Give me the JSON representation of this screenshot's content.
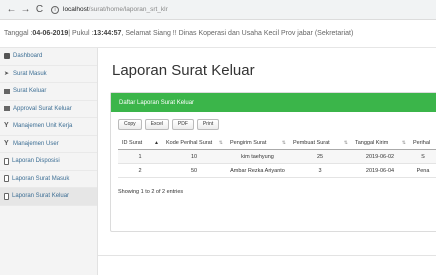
{
  "browser": {
    "back": "←",
    "forward": "→",
    "reload": "C",
    "info": "i",
    "url_host": "localhost",
    "url_path": "/surat/home/laporan_srt_klr"
  },
  "topbar": {
    "prefix": "Tanggal : ",
    "date": "04-06-2019",
    "mid": " | Pukul : ",
    "time": "13:44:57",
    "greeting": " , Selamat Siang !! Dinas Koperasi dan Usaha Kecil Prov jabar (Sekretariat)"
  },
  "sidebar": {
    "items": [
      {
        "label": "Dashboard"
      },
      {
        "label": "Surat Masuk"
      },
      {
        "label": "Surat Keluar"
      },
      {
        "label": "Approval Surat Keluar"
      },
      {
        "label": "Manajemen Unit Kerja"
      },
      {
        "label": "Manajemen User"
      },
      {
        "label": "Laporan Disposisi"
      },
      {
        "label": "Laporan Surat Masuk"
      },
      {
        "label": "Laporan Surat Keluar"
      }
    ]
  },
  "main": {
    "title": "Laporan Surat Keluar",
    "panel_title": "Daftar Laporan Surat Keluar",
    "buttons": [
      "Copy",
      "Excel",
      "PDF",
      "Print"
    ],
    "columns": [
      "ID Surat",
      "Kode Perihal Surat",
      "Pengirim Surat",
      "Pembuat Surat",
      "Tanggal Kirim",
      "Perihal"
    ],
    "rows": [
      [
        "1",
        "10",
        "kim taehyung",
        "25",
        "2019-06-02",
        "S"
      ],
      [
        "2",
        "50",
        "Ambar Rezka Ariyanto",
        "3",
        "2019-06-04",
        "Pena"
      ]
    ],
    "info": "Showing 1 to 2 of 2 entries"
  }
}
